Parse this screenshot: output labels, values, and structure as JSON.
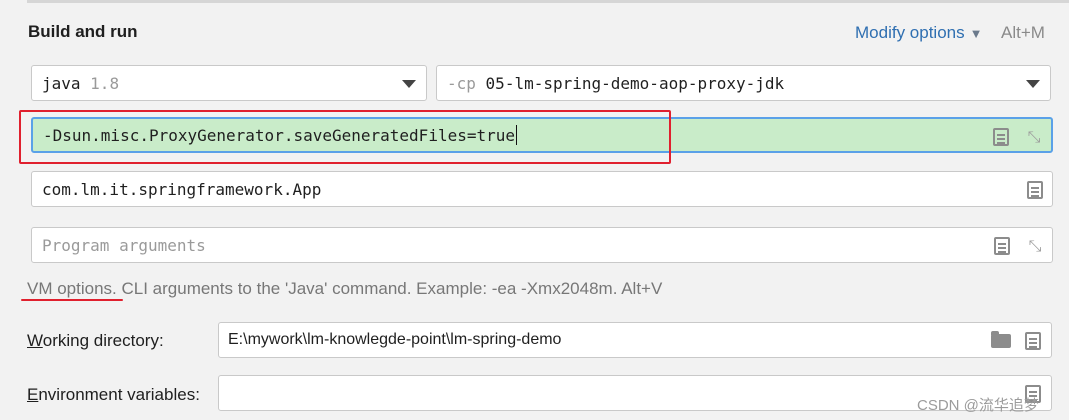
{
  "section": {
    "title": "Build and run",
    "modify_label": "Modify options",
    "modify_shortcut": "Alt+M"
  },
  "jdk": {
    "name": "java",
    "version": "1.8"
  },
  "classpath": {
    "prefix": "-cp",
    "module": "05-lm-spring-demo-aop-proxy-jdk"
  },
  "vm_options": {
    "value": "-Dsun.misc.ProxyGenerator.saveGeneratedFiles=true"
  },
  "main_class": {
    "value": "com.lm.it.springframework.App"
  },
  "program_args": {
    "placeholder": "Program arguments"
  },
  "hint": {
    "highlight": "VM options.",
    "text": " CLI arguments to the 'Java' command. Example: -ea -Xmx2048m. Alt+V"
  },
  "working_directory": {
    "label_first": "W",
    "label_rest": "orking directory:",
    "value": "E:\\mywork\\lm-knowlegde-point\\lm-spring-demo"
  },
  "environment": {
    "label_first": "E",
    "label_rest": "nvironment variables:",
    "value": ""
  },
  "watermark": "CSDN @流华追梦",
  "icons": [
    "chevron-down-icon",
    "dropdown-arrow-icon",
    "document-icon",
    "expand-icon",
    "folder-icon"
  ],
  "colors": {
    "accent": "#2f6fb1",
    "vm_field_bg": "#c9ecc9",
    "focus_border": "#5aa1e8",
    "annotation_red": "#e0202e"
  }
}
